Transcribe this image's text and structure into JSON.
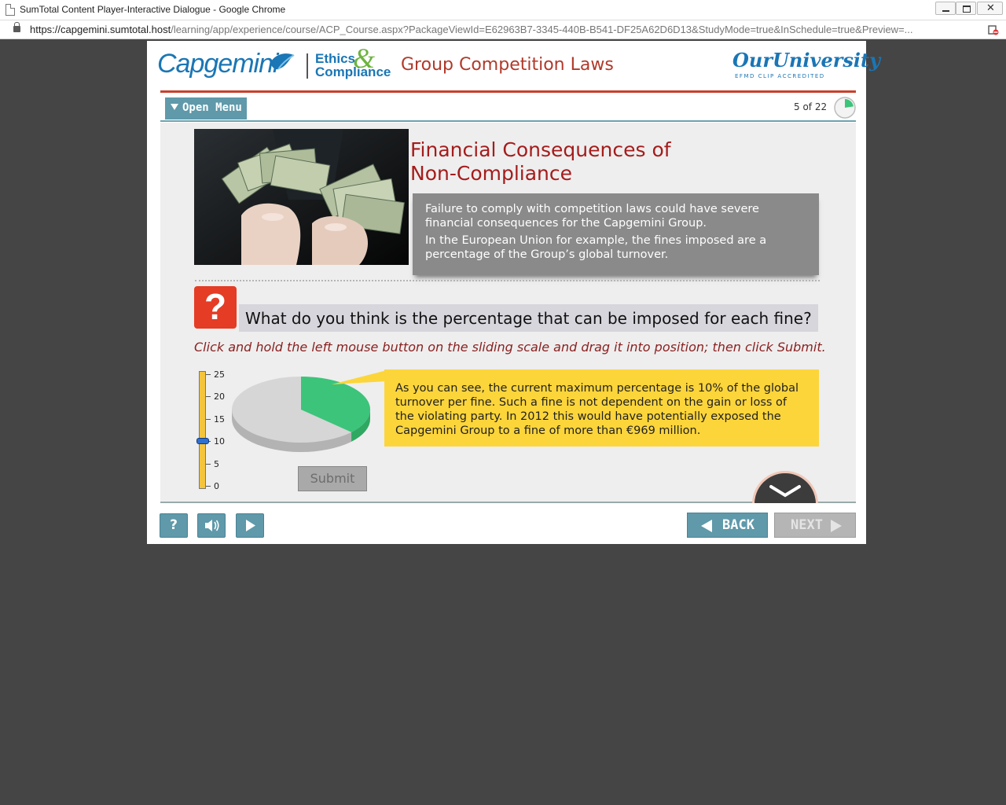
{
  "window": {
    "title": "SumTotal Content Player-Interactive Dialogue - Google Chrome",
    "url_host": "https://capgemini.sumtotal.host",
    "url_path": "/learning/app/experience/course/ACP_Course.aspx?PackageViewId=E62963B7-3345-440B-B541-DF25A62D6D13&StudyMode=true&InSchedule=true&Preview=...",
    "close_glyph": "✕"
  },
  "header": {
    "capgemini_logo": "Capgemini",
    "ethics_logo_line1": "Ethics",
    "ethics_logo_line2": "Compliance",
    "ethics_logo_amp": "&",
    "course_title": "Group Competition Laws",
    "university_logo": "OurUniversity",
    "university_sub": "EFMD CLIP ACCREDITED"
  },
  "menu": {
    "open_menu_label": "Open Menu",
    "page_count": "5 of 22",
    "progress_fraction": 0.227
  },
  "slide": {
    "title_line1": "Financial Consequences of",
    "title_line2": "Non-Compliance",
    "info_p1": "Failure to comply with competition laws could have severe financial consequences for the Capgemini Group.",
    "info_p2": "In the European Union for example, the fines imposed are a percentage of the Group’s global turnover.",
    "question_mark": "?",
    "question": "What do you think is the percentage that can be imposed for each fine?",
    "instruction": "Click and hold the left mouse button on the sliding scale and drag it into position; then click Submit.",
    "slider_labels": [
      "25",
      "20",
      "15",
      "10",
      "5",
      "0"
    ],
    "slider_value": 10,
    "slider_max": 25,
    "submit_label": "Submit",
    "feedback": "As you can see, the current maximum percentage is 10% of the global turnover per fine. Such a fine is not dependent on the gain or loss of the violating party. In 2012 this would have potentially exposed the Capgemini Group to a fine of more than €969 million."
  },
  "footer": {
    "help_label": "?",
    "back_label": "BACK",
    "next_label": "NEXT"
  },
  "colors": {
    "brand_blue": "#1a76b5",
    "accent_red": "#c8402d",
    "teal_button": "#5f99aa",
    "pie_green": "#3cc47a",
    "feedback_yellow": "#fcd53a"
  }
}
